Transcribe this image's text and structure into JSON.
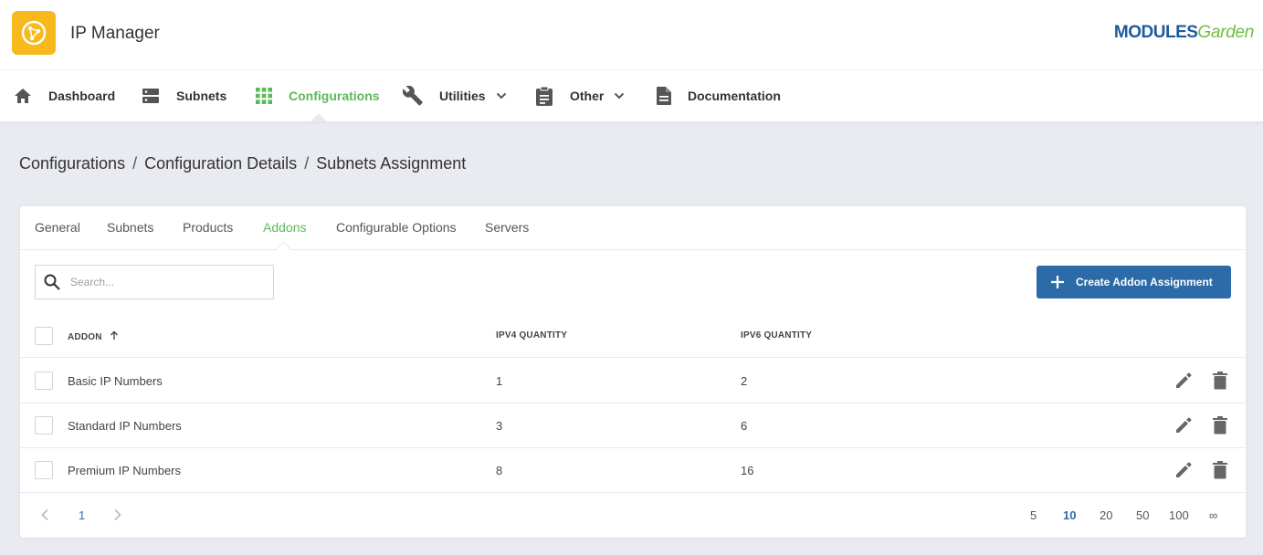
{
  "app": {
    "title": "IP Manager",
    "brand_part1": "MODULES",
    "brand_part2": "Garden"
  },
  "nav": {
    "items": [
      {
        "label": "Dashboard",
        "icon": "home-icon"
      },
      {
        "label": "Subnets",
        "icon": "server-icon"
      },
      {
        "label": "Configurations",
        "icon": "grid-icon",
        "active": true
      },
      {
        "label": "Utilities",
        "icon": "wrench-icon",
        "dropdown": true
      },
      {
        "label": "Other",
        "icon": "clipboard-icon",
        "dropdown": true
      },
      {
        "label": "Documentation",
        "icon": "document-icon"
      }
    ]
  },
  "breadcrumb": {
    "items": [
      "Configurations",
      "Configuration Details",
      "Subnets Assignment"
    ],
    "separator": "/"
  },
  "tabs": {
    "items": [
      "General",
      "Subnets",
      "Products",
      "Addons",
      "Configurable Options",
      "Servers"
    ],
    "active": "Addons"
  },
  "search": {
    "placeholder": "Search...",
    "value": ""
  },
  "create_button": {
    "label": "Create Addon Assignment",
    "icon": "plus-icon"
  },
  "table": {
    "columns": [
      "ADDON",
      "IPV4 QUANTITY",
      "IPV6 QUANTITY"
    ],
    "sort_column": "ADDON",
    "sort_direction": "ascending",
    "rows": [
      {
        "addon": "Basic IP Numbers",
        "ipv4": "1",
        "ipv6": "2"
      },
      {
        "addon": "Standard IP Numbers",
        "ipv4": "3",
        "ipv6": "6"
      },
      {
        "addon": "Premium IP Numbers",
        "ipv4": "8",
        "ipv6": "16"
      }
    ],
    "row_actions": [
      "edit-icon",
      "trash-icon"
    ]
  },
  "pagination": {
    "current_page": "1",
    "per_page_options": [
      "5",
      "10",
      "20",
      "50",
      "100",
      "∞"
    ],
    "per_page_selected": "10"
  },
  "colors": {
    "accent_green": "#5cb85c",
    "primary_blue": "#2c6aa8",
    "logo_yellow": "#f7b91c",
    "background": "#e9ebf0"
  }
}
